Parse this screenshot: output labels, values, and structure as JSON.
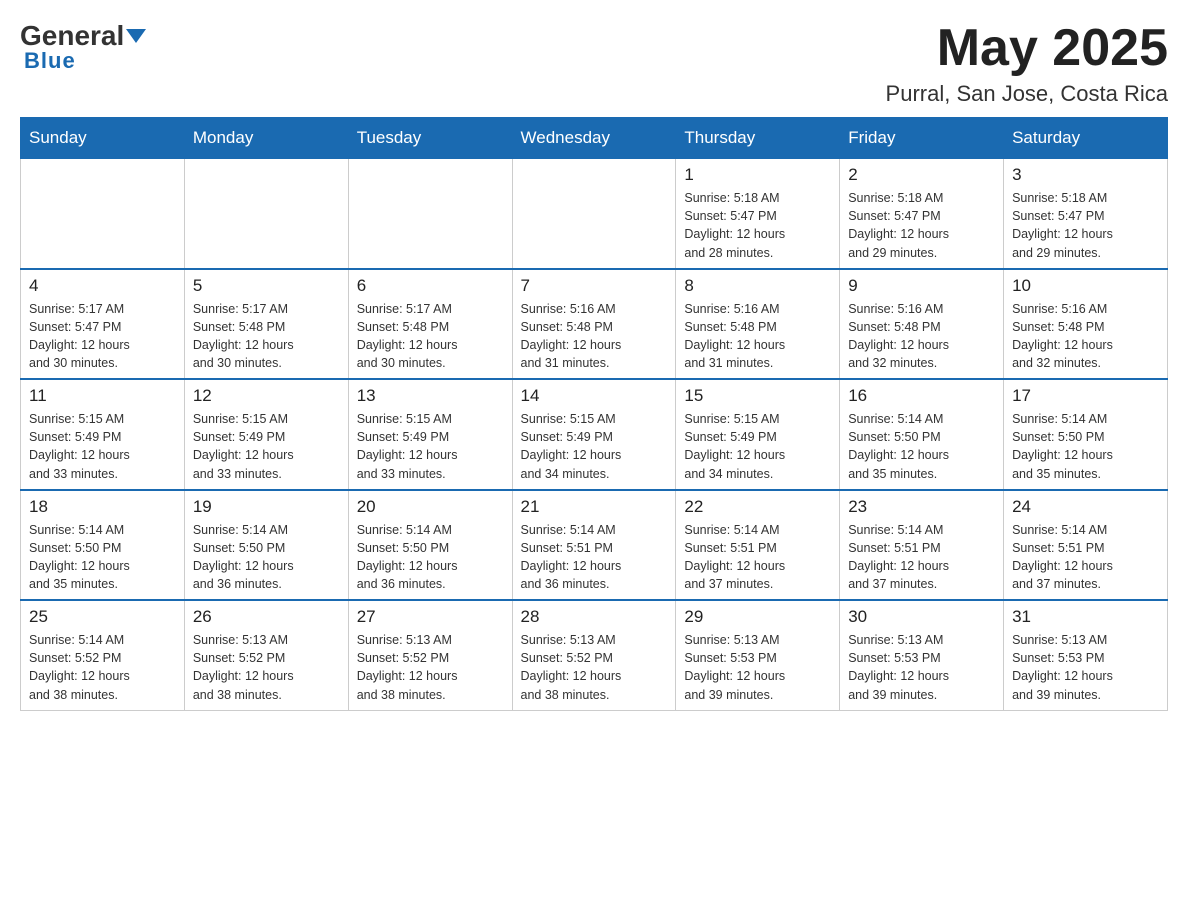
{
  "header": {
    "logo_general": "General",
    "logo_blue": "Blue",
    "month_title": "May 2025",
    "location": "Purral, San Jose, Costa Rica"
  },
  "weekdays": [
    "Sunday",
    "Monday",
    "Tuesday",
    "Wednesday",
    "Thursday",
    "Friday",
    "Saturday"
  ],
  "weeks": [
    [
      {
        "day": "",
        "info": ""
      },
      {
        "day": "",
        "info": ""
      },
      {
        "day": "",
        "info": ""
      },
      {
        "day": "",
        "info": ""
      },
      {
        "day": "1",
        "info": "Sunrise: 5:18 AM\nSunset: 5:47 PM\nDaylight: 12 hours\nand 28 minutes."
      },
      {
        "day": "2",
        "info": "Sunrise: 5:18 AM\nSunset: 5:47 PM\nDaylight: 12 hours\nand 29 minutes."
      },
      {
        "day": "3",
        "info": "Sunrise: 5:18 AM\nSunset: 5:47 PM\nDaylight: 12 hours\nand 29 minutes."
      }
    ],
    [
      {
        "day": "4",
        "info": "Sunrise: 5:17 AM\nSunset: 5:47 PM\nDaylight: 12 hours\nand 30 minutes."
      },
      {
        "day": "5",
        "info": "Sunrise: 5:17 AM\nSunset: 5:48 PM\nDaylight: 12 hours\nand 30 minutes."
      },
      {
        "day": "6",
        "info": "Sunrise: 5:17 AM\nSunset: 5:48 PM\nDaylight: 12 hours\nand 30 minutes."
      },
      {
        "day": "7",
        "info": "Sunrise: 5:16 AM\nSunset: 5:48 PM\nDaylight: 12 hours\nand 31 minutes."
      },
      {
        "day": "8",
        "info": "Sunrise: 5:16 AM\nSunset: 5:48 PM\nDaylight: 12 hours\nand 31 minutes."
      },
      {
        "day": "9",
        "info": "Sunrise: 5:16 AM\nSunset: 5:48 PM\nDaylight: 12 hours\nand 32 minutes."
      },
      {
        "day": "10",
        "info": "Sunrise: 5:16 AM\nSunset: 5:48 PM\nDaylight: 12 hours\nand 32 minutes."
      }
    ],
    [
      {
        "day": "11",
        "info": "Sunrise: 5:15 AM\nSunset: 5:49 PM\nDaylight: 12 hours\nand 33 minutes."
      },
      {
        "day": "12",
        "info": "Sunrise: 5:15 AM\nSunset: 5:49 PM\nDaylight: 12 hours\nand 33 minutes."
      },
      {
        "day": "13",
        "info": "Sunrise: 5:15 AM\nSunset: 5:49 PM\nDaylight: 12 hours\nand 33 minutes."
      },
      {
        "day": "14",
        "info": "Sunrise: 5:15 AM\nSunset: 5:49 PM\nDaylight: 12 hours\nand 34 minutes."
      },
      {
        "day": "15",
        "info": "Sunrise: 5:15 AM\nSunset: 5:49 PM\nDaylight: 12 hours\nand 34 minutes."
      },
      {
        "day": "16",
        "info": "Sunrise: 5:14 AM\nSunset: 5:50 PM\nDaylight: 12 hours\nand 35 minutes."
      },
      {
        "day": "17",
        "info": "Sunrise: 5:14 AM\nSunset: 5:50 PM\nDaylight: 12 hours\nand 35 minutes."
      }
    ],
    [
      {
        "day": "18",
        "info": "Sunrise: 5:14 AM\nSunset: 5:50 PM\nDaylight: 12 hours\nand 35 minutes."
      },
      {
        "day": "19",
        "info": "Sunrise: 5:14 AM\nSunset: 5:50 PM\nDaylight: 12 hours\nand 36 minutes."
      },
      {
        "day": "20",
        "info": "Sunrise: 5:14 AM\nSunset: 5:50 PM\nDaylight: 12 hours\nand 36 minutes."
      },
      {
        "day": "21",
        "info": "Sunrise: 5:14 AM\nSunset: 5:51 PM\nDaylight: 12 hours\nand 36 minutes."
      },
      {
        "day": "22",
        "info": "Sunrise: 5:14 AM\nSunset: 5:51 PM\nDaylight: 12 hours\nand 37 minutes."
      },
      {
        "day": "23",
        "info": "Sunrise: 5:14 AM\nSunset: 5:51 PM\nDaylight: 12 hours\nand 37 minutes."
      },
      {
        "day": "24",
        "info": "Sunrise: 5:14 AM\nSunset: 5:51 PM\nDaylight: 12 hours\nand 37 minutes."
      }
    ],
    [
      {
        "day": "25",
        "info": "Sunrise: 5:14 AM\nSunset: 5:52 PM\nDaylight: 12 hours\nand 38 minutes."
      },
      {
        "day": "26",
        "info": "Sunrise: 5:13 AM\nSunset: 5:52 PM\nDaylight: 12 hours\nand 38 minutes."
      },
      {
        "day": "27",
        "info": "Sunrise: 5:13 AM\nSunset: 5:52 PM\nDaylight: 12 hours\nand 38 minutes."
      },
      {
        "day": "28",
        "info": "Sunrise: 5:13 AM\nSunset: 5:52 PM\nDaylight: 12 hours\nand 38 minutes."
      },
      {
        "day": "29",
        "info": "Sunrise: 5:13 AM\nSunset: 5:53 PM\nDaylight: 12 hours\nand 39 minutes."
      },
      {
        "day": "30",
        "info": "Sunrise: 5:13 AM\nSunset: 5:53 PM\nDaylight: 12 hours\nand 39 minutes."
      },
      {
        "day": "31",
        "info": "Sunrise: 5:13 AM\nSunset: 5:53 PM\nDaylight: 12 hours\nand 39 minutes."
      }
    ]
  ]
}
